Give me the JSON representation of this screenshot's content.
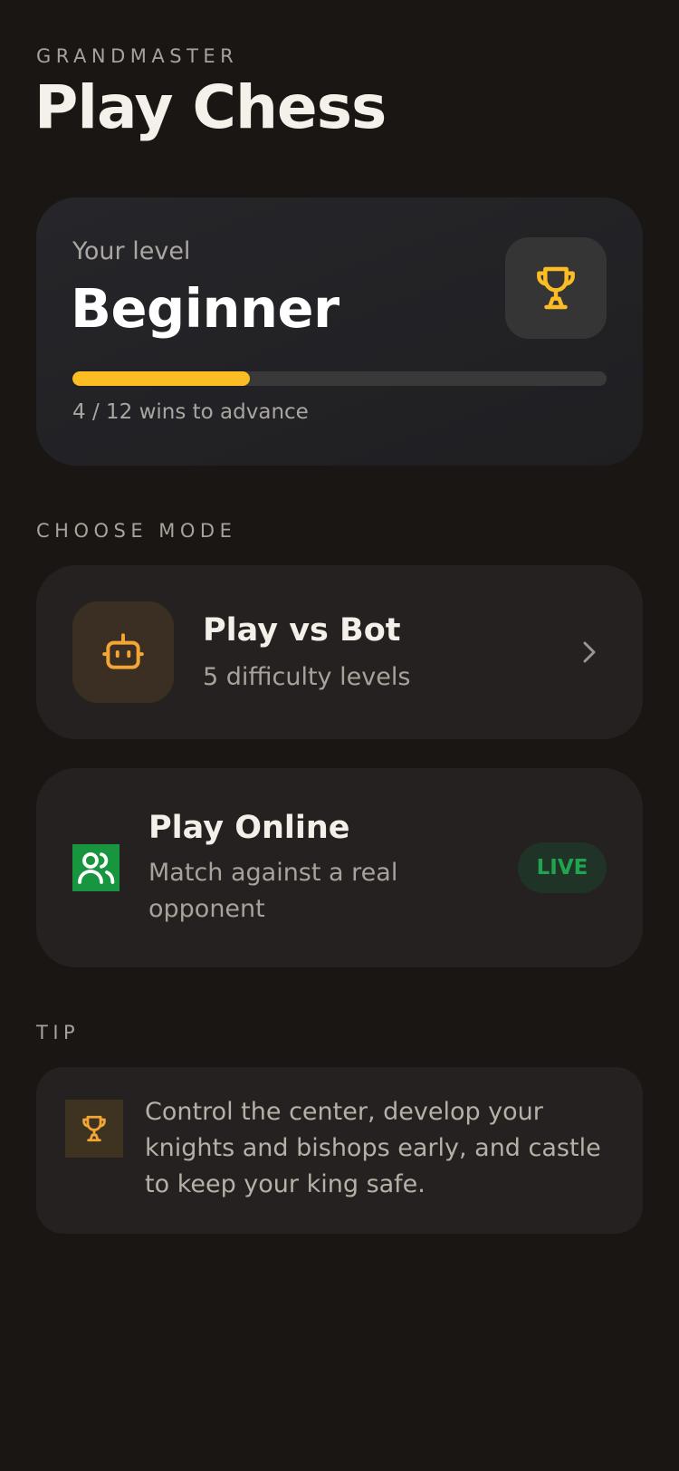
{
  "header": {
    "eyebrow": "GRANDMASTER",
    "title": "Play Chess"
  },
  "level_card": {
    "label": "Your level",
    "value": "Beginner",
    "progress_current": 4,
    "progress_total": 12,
    "progress_fraction": 0.333,
    "caption": "4 / 12 wins to advance",
    "icon": "trophy-icon"
  },
  "modes": {
    "section_label": "CHOOSE MODE",
    "bot": {
      "title": "Play vs Bot",
      "subtitle": "5 difficulty levels",
      "icon": "robot-icon"
    },
    "online": {
      "title": "Play Online",
      "subtitle_line1": "Match against a real",
      "subtitle_line2": "opponent",
      "badge": "LIVE",
      "icon": "users-icon"
    }
  },
  "tip": {
    "section_label": "TIP",
    "text": "Control the center, develop your knights and bishops early, and castle to keep your king safe.",
    "icon": "trophy-icon"
  },
  "colors": {
    "background": "#1a1614",
    "accent": "#fbbd23",
    "live_green": "#22a34f",
    "card": "#242120"
  }
}
